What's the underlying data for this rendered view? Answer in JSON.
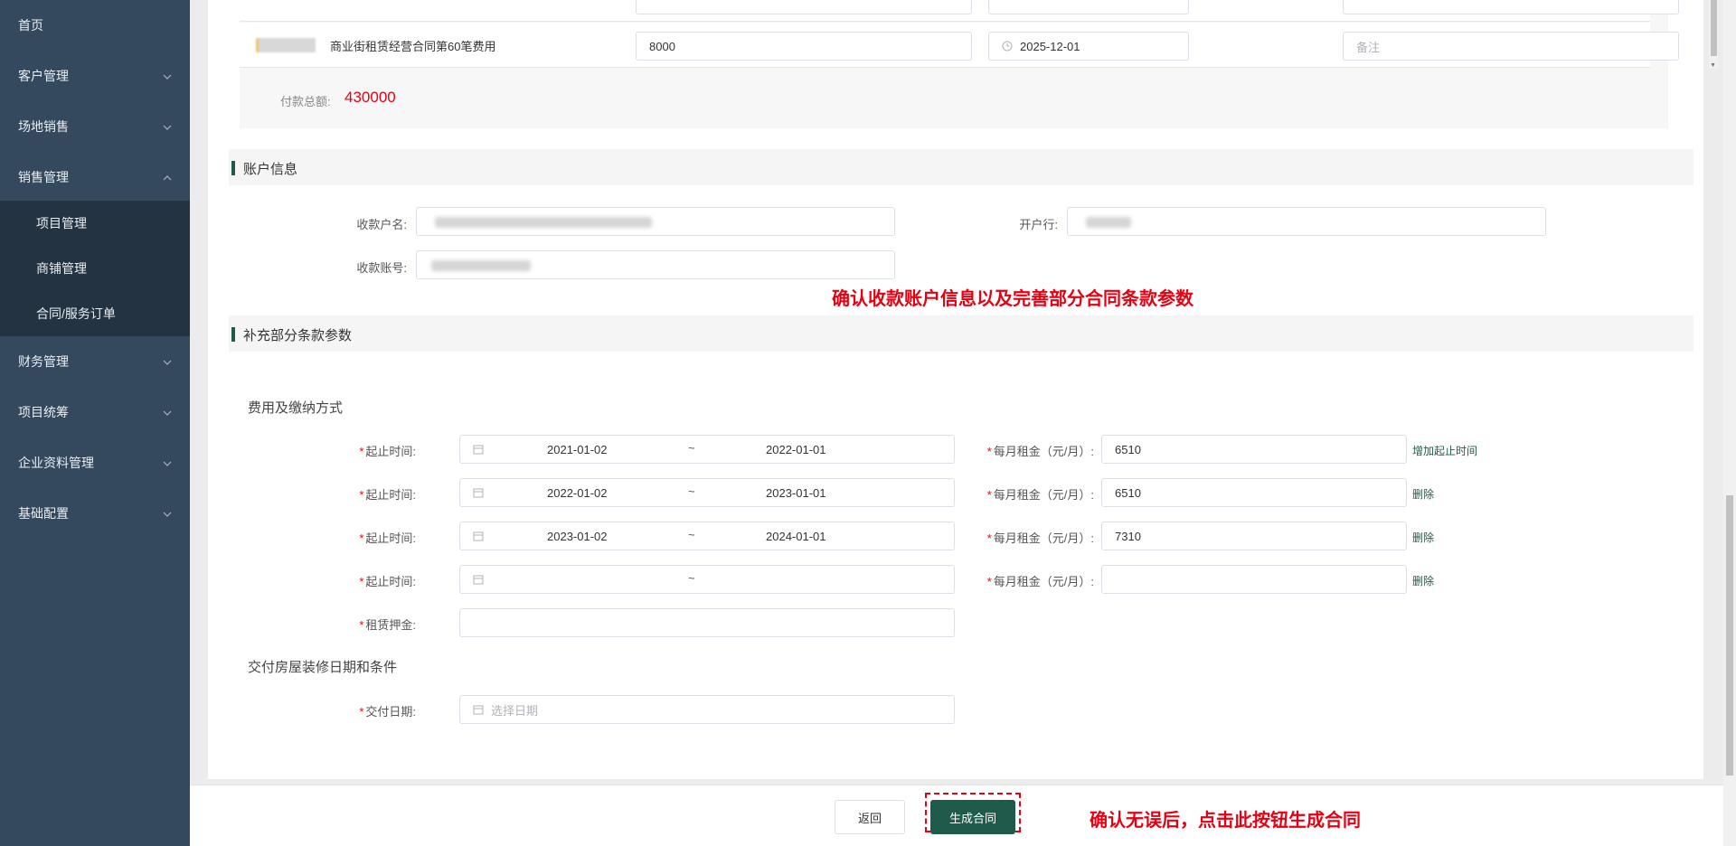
{
  "sidebar": {
    "items": [
      {
        "label": "首页"
      },
      {
        "label": "客户管理"
      },
      {
        "label": "场地销售"
      },
      {
        "label": "销售管理"
      },
      {
        "label": "财务管理"
      },
      {
        "label": "项目统筹"
      },
      {
        "label": "企业资料管理"
      },
      {
        "label": "基础配置"
      }
    ],
    "sales_submenu": [
      {
        "label": "项目管理"
      },
      {
        "label": "商铺管理"
      },
      {
        "label": "合同/服务订单"
      }
    ]
  },
  "payment_table": {
    "row": {
      "title": "商业街租赁经营合同第60笔费用",
      "amount": "8000",
      "date": "2025-12-01",
      "remark_placeholder": "备注"
    },
    "total_label": "付款总额:",
    "total_value": "430000"
  },
  "account_section": {
    "title": "账户信息",
    "payee_name_label": "收款户名:",
    "bank_label": "开户行:",
    "account_no_label": "收款账号:"
  },
  "annotation_account": "确认收款账户信息以及完善部分合同条款参数",
  "supplement_section": {
    "title": "补充部分条款参数",
    "fee_heading": "费用及缴纳方式",
    "period_label": "起止时间:",
    "rent_label": "每月租金（元/月）:",
    "rows": [
      {
        "start": "2021-01-02",
        "end": "2022-01-01",
        "rent": "6510",
        "action": "增加起止时间"
      },
      {
        "start": "2022-01-02",
        "end": "2023-01-01",
        "rent": "6510",
        "action": "删除"
      },
      {
        "start": "2023-01-02",
        "end": "2024-01-01",
        "rent": "7310",
        "action": "删除"
      },
      {
        "start": "",
        "end": "",
        "rent": "",
        "action": "删除"
      }
    ],
    "tilde": "~",
    "deposit_label": "租赁押金:",
    "delivery_heading": "交付房屋装修日期和条件",
    "delivery_date_label": "交付日期:",
    "delivery_date_placeholder": "选择日期"
  },
  "footer": {
    "back_label": "返回",
    "generate_label": "生成合同",
    "annotation": "确认无误后，点击此按钮生成合同"
  },
  "colors": {
    "sidebar_bg": "#34495e",
    "submenu_bg": "#243342",
    "primary": "#1f5a4b",
    "annotation_red": "#e60012"
  }
}
